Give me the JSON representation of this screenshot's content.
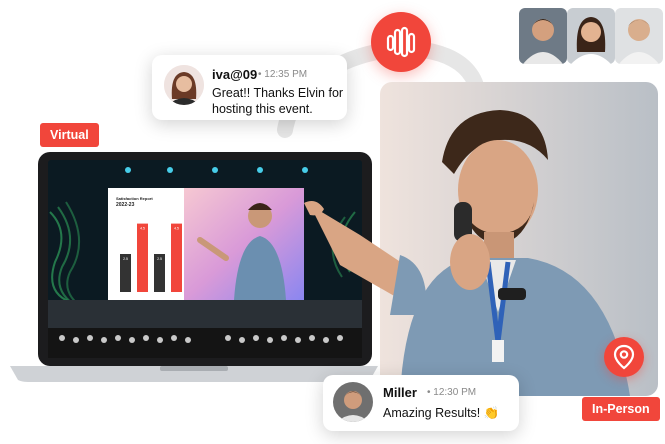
{
  "chat_top": {
    "name": "iva@09",
    "time": "12:35 PM",
    "message_line1": "Great!! Thanks Elvin for",
    "message_line2": "hosting this event."
  },
  "chat_bottom": {
    "name": "Miller",
    "time": "12:30 PM",
    "message": "Amazing Results! 👏"
  },
  "labels": {
    "virtual": "Virtual",
    "in_person": "In-Person"
  },
  "slide": {
    "title": "Satisfaction Report",
    "subtitle": "2022-23"
  },
  "chart_bars": [
    {
      "label": "2.5",
      "value": 2.5,
      "color": "#333333"
    },
    {
      "label": "4.5",
      "value": 4.5,
      "color": "#f1463b"
    },
    {
      "label": "2.5",
      "value": 2.5,
      "color": "#333333"
    },
    {
      "label": "4.5",
      "value": 4.5,
      "color": "#f1463b"
    }
  ],
  "icons": {
    "wave": "audio-wave-icon",
    "pin": "location-pin-icon"
  },
  "colors": {
    "accent": "#f1463b"
  }
}
